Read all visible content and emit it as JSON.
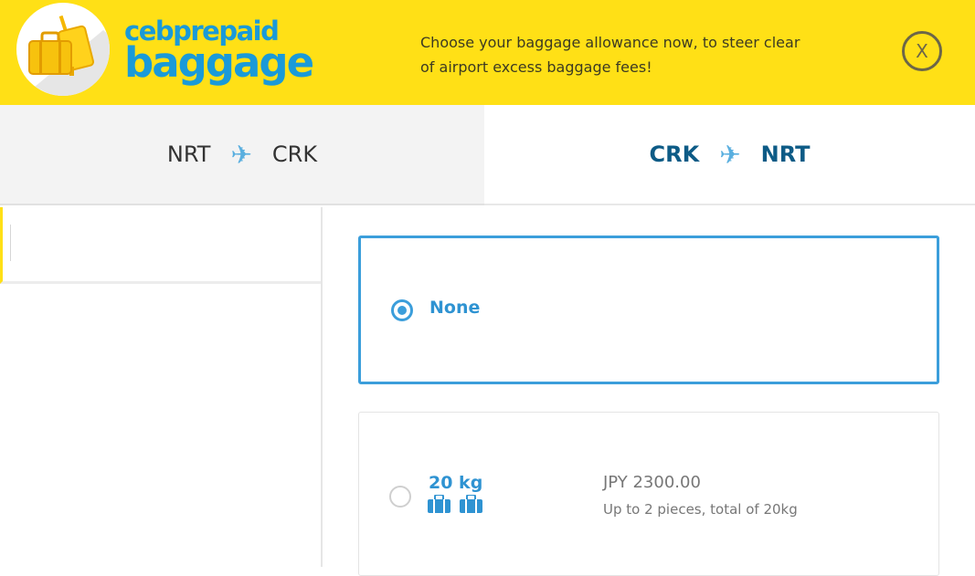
{
  "header": {
    "logo_top": "cebprepaid",
    "logo_bottom": "baggage",
    "message": "Choose your baggage allowance now, to steer clear of airport excess baggage fees!",
    "close_label": "X"
  },
  "tabs": [
    {
      "from": "NRT",
      "to": "CRK",
      "icon": "plane-icon",
      "active": false
    },
    {
      "from": "CRK",
      "to": "NRT",
      "icon": "plane-icon",
      "active": true
    }
  ],
  "options": [
    {
      "label": "None",
      "selected": true
    },
    {
      "label": "20 kg",
      "price": "JPY 2300.00",
      "description": "Up to 2 pieces, total of 20kg",
      "bag_icons": 2,
      "selected": false
    }
  ],
  "colors": {
    "brand_yellow": "#ffe016",
    "brand_blue": "#1a9ad8",
    "selected_border": "#3b9edb",
    "active_tab_text": "#0d5b86"
  }
}
